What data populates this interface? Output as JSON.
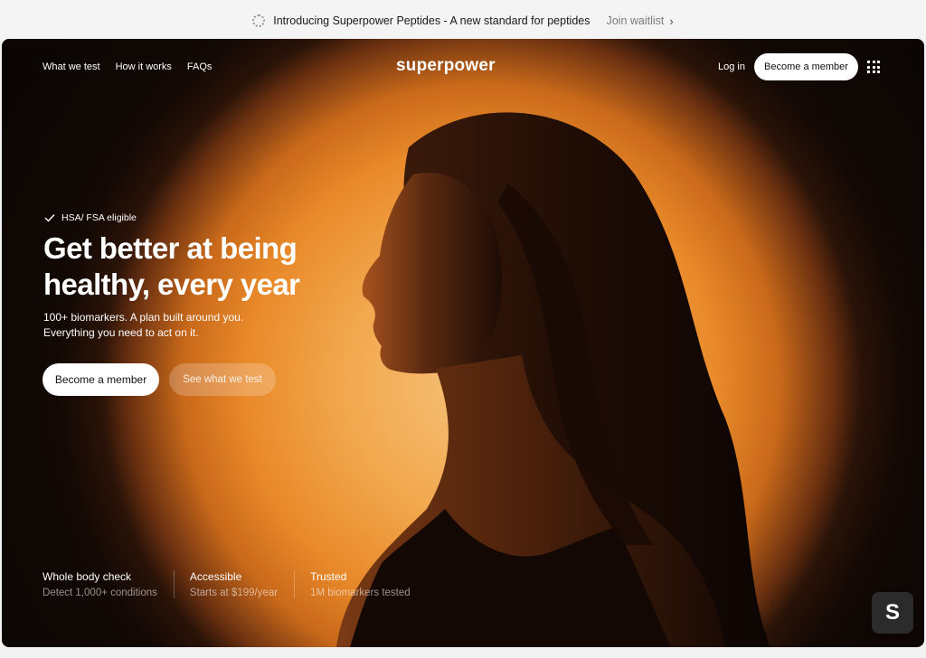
{
  "announcement": {
    "message": "Introducing Superpower Peptides - A new standard for peptides",
    "link": "Join waitlist"
  },
  "nav": {
    "links": [
      "What we test",
      "How it works",
      "FAQs"
    ],
    "logo": "superpower",
    "login": "Log in",
    "cta": "Become a member"
  },
  "hero": {
    "eligible": "HSA/ FSA eligible",
    "headline_line1": "Get better at being",
    "headline_line2": "healthy, every year",
    "sub_line1": "100+ biomarkers. A plan built around you.",
    "sub_line2": "Everything you need to act on it.",
    "primary_cta": "Become a member",
    "secondary_cta": "See what we test"
  },
  "features": [
    {
      "title": "Whole body check",
      "desc": "Detect 1,000+ conditions"
    },
    {
      "title": "Accessible",
      "desc": "Starts at $199/year"
    },
    {
      "title": "Trusted",
      "desc": "1M biomarkers tested"
    }
  ],
  "badge": "S",
  "colors": {
    "glow_center": "#f6c27a",
    "glow_mid": "#e98a2a",
    "background": "#0b0604",
    "button": "#ffffff"
  }
}
